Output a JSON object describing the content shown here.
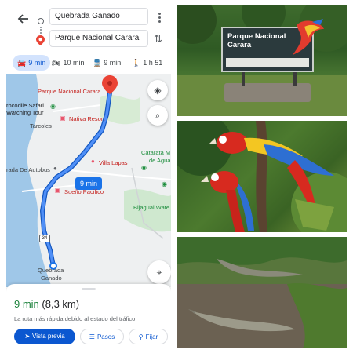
{
  "maps": {
    "origin": "Quebrada Ganado",
    "destination": "Parque Nacional Carara",
    "modes": [
      {
        "icon": "car-icon",
        "label": "9 min",
        "active": true
      },
      {
        "icon": "motorcycle-icon",
        "label": "10 min",
        "active": false
      },
      {
        "icon": "transit-icon",
        "label": "9 min",
        "active": false
      },
      {
        "icon": "walk-icon",
        "label": "1 h 51",
        "active": false
      }
    ],
    "map_labels": {
      "destination": "Parque Nacional Carara",
      "crocodile_safari_1": "rocodile Safari",
      "crocodile_safari_2": "Watching Tour",
      "tarcoles": "Tarcoles",
      "nativa": "Nativa Resort",
      "villa_lapas": "Villa Lapas",
      "catarata_1": "Catarata M",
      "catarata_2": "de Agua Vi",
      "bus": "rada De Autobus",
      "sueno": "Sueño Pacifico",
      "bijagual": "Bijagual Wate",
      "origin_1": "Quebrada",
      "origin_2": "Ganado",
      "route_shield": "34"
    },
    "route_time_badge": "9 min",
    "eta_time": "9 min",
    "eta_distance": "(8,3 km)",
    "route_note": "La ruta más rápida debido al estado del tráfico",
    "buttons": {
      "preview": "Vista previa",
      "steps": "Pasos",
      "pin": "Fijar"
    },
    "colors": {
      "route": "#1a73e8",
      "accent": "#0b57d0",
      "eta": "#188038",
      "pin": "#ea4335"
    }
  },
  "photos": {
    "sign_title_line1": "Parque Nacional",
    "sign_title_line2": "Carara"
  }
}
